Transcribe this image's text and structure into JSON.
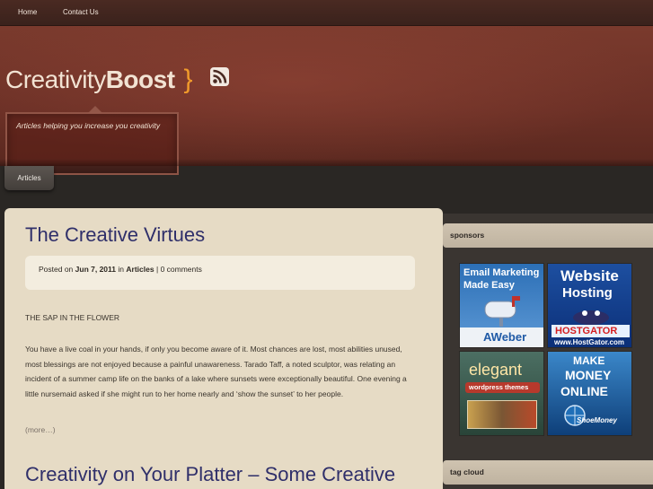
{
  "nav": {
    "home": "Home",
    "contact": "Contact Us"
  },
  "site": {
    "title_light": "Creativity",
    "title_bold": "Boost",
    "brace": "}",
    "tagline": "Articles helping you increase you creativity"
  },
  "category_tab": "Articles",
  "posts": [
    {
      "title": "The Creative Virtues",
      "meta_prefix": "Posted on",
      "date": "Jun 7, 2011",
      "meta_in": "in",
      "category": "Articles",
      "separator": "|",
      "comments": "0 comments",
      "section_heading": "THE SAP IN THE FLOWER",
      "excerpt": "You have a live coal in your hands, if only you become aware of it. Most chances are lost, most abilities unused, most blessings are not enjoyed because a painful unawareness. Tarado Taff, a noted sculptor, was relating an incident of a summer camp life on the banks of a lake where sunsets were exceptionally beautiful. One evening a little nursemaid asked if she might run to her home nearly and ‘show the sunset’ to her people.",
      "more": "(more…)"
    },
    {
      "title": "Creativity on Your Platter – Some Creative"
    }
  ],
  "sidebar": {
    "sponsors_heading": "sponsors",
    "tagcloud_heading": "tag cloud",
    "ads": [
      {
        "line1": "Email Marketing",
        "line2": "Made Easy",
        "brand": "AWeber"
      },
      {
        "line1": "Website",
        "line2": "Hosting",
        "brand": "HOSTGATOR",
        "url": "www.HostGator.com"
      },
      {
        "line1": "elegant",
        "line2": "wordpress themes"
      },
      {
        "line1": "MAKE",
        "line2": "MONEY",
        "line3": "ONLINE",
        "brand": "ShoeMoney"
      }
    ]
  },
  "colors": {
    "accent_orange": "#f19b2b",
    "title_blue": "#2f2f6a",
    "header_red": "#6b3026",
    "content_bg": "#e6dbc5"
  }
}
